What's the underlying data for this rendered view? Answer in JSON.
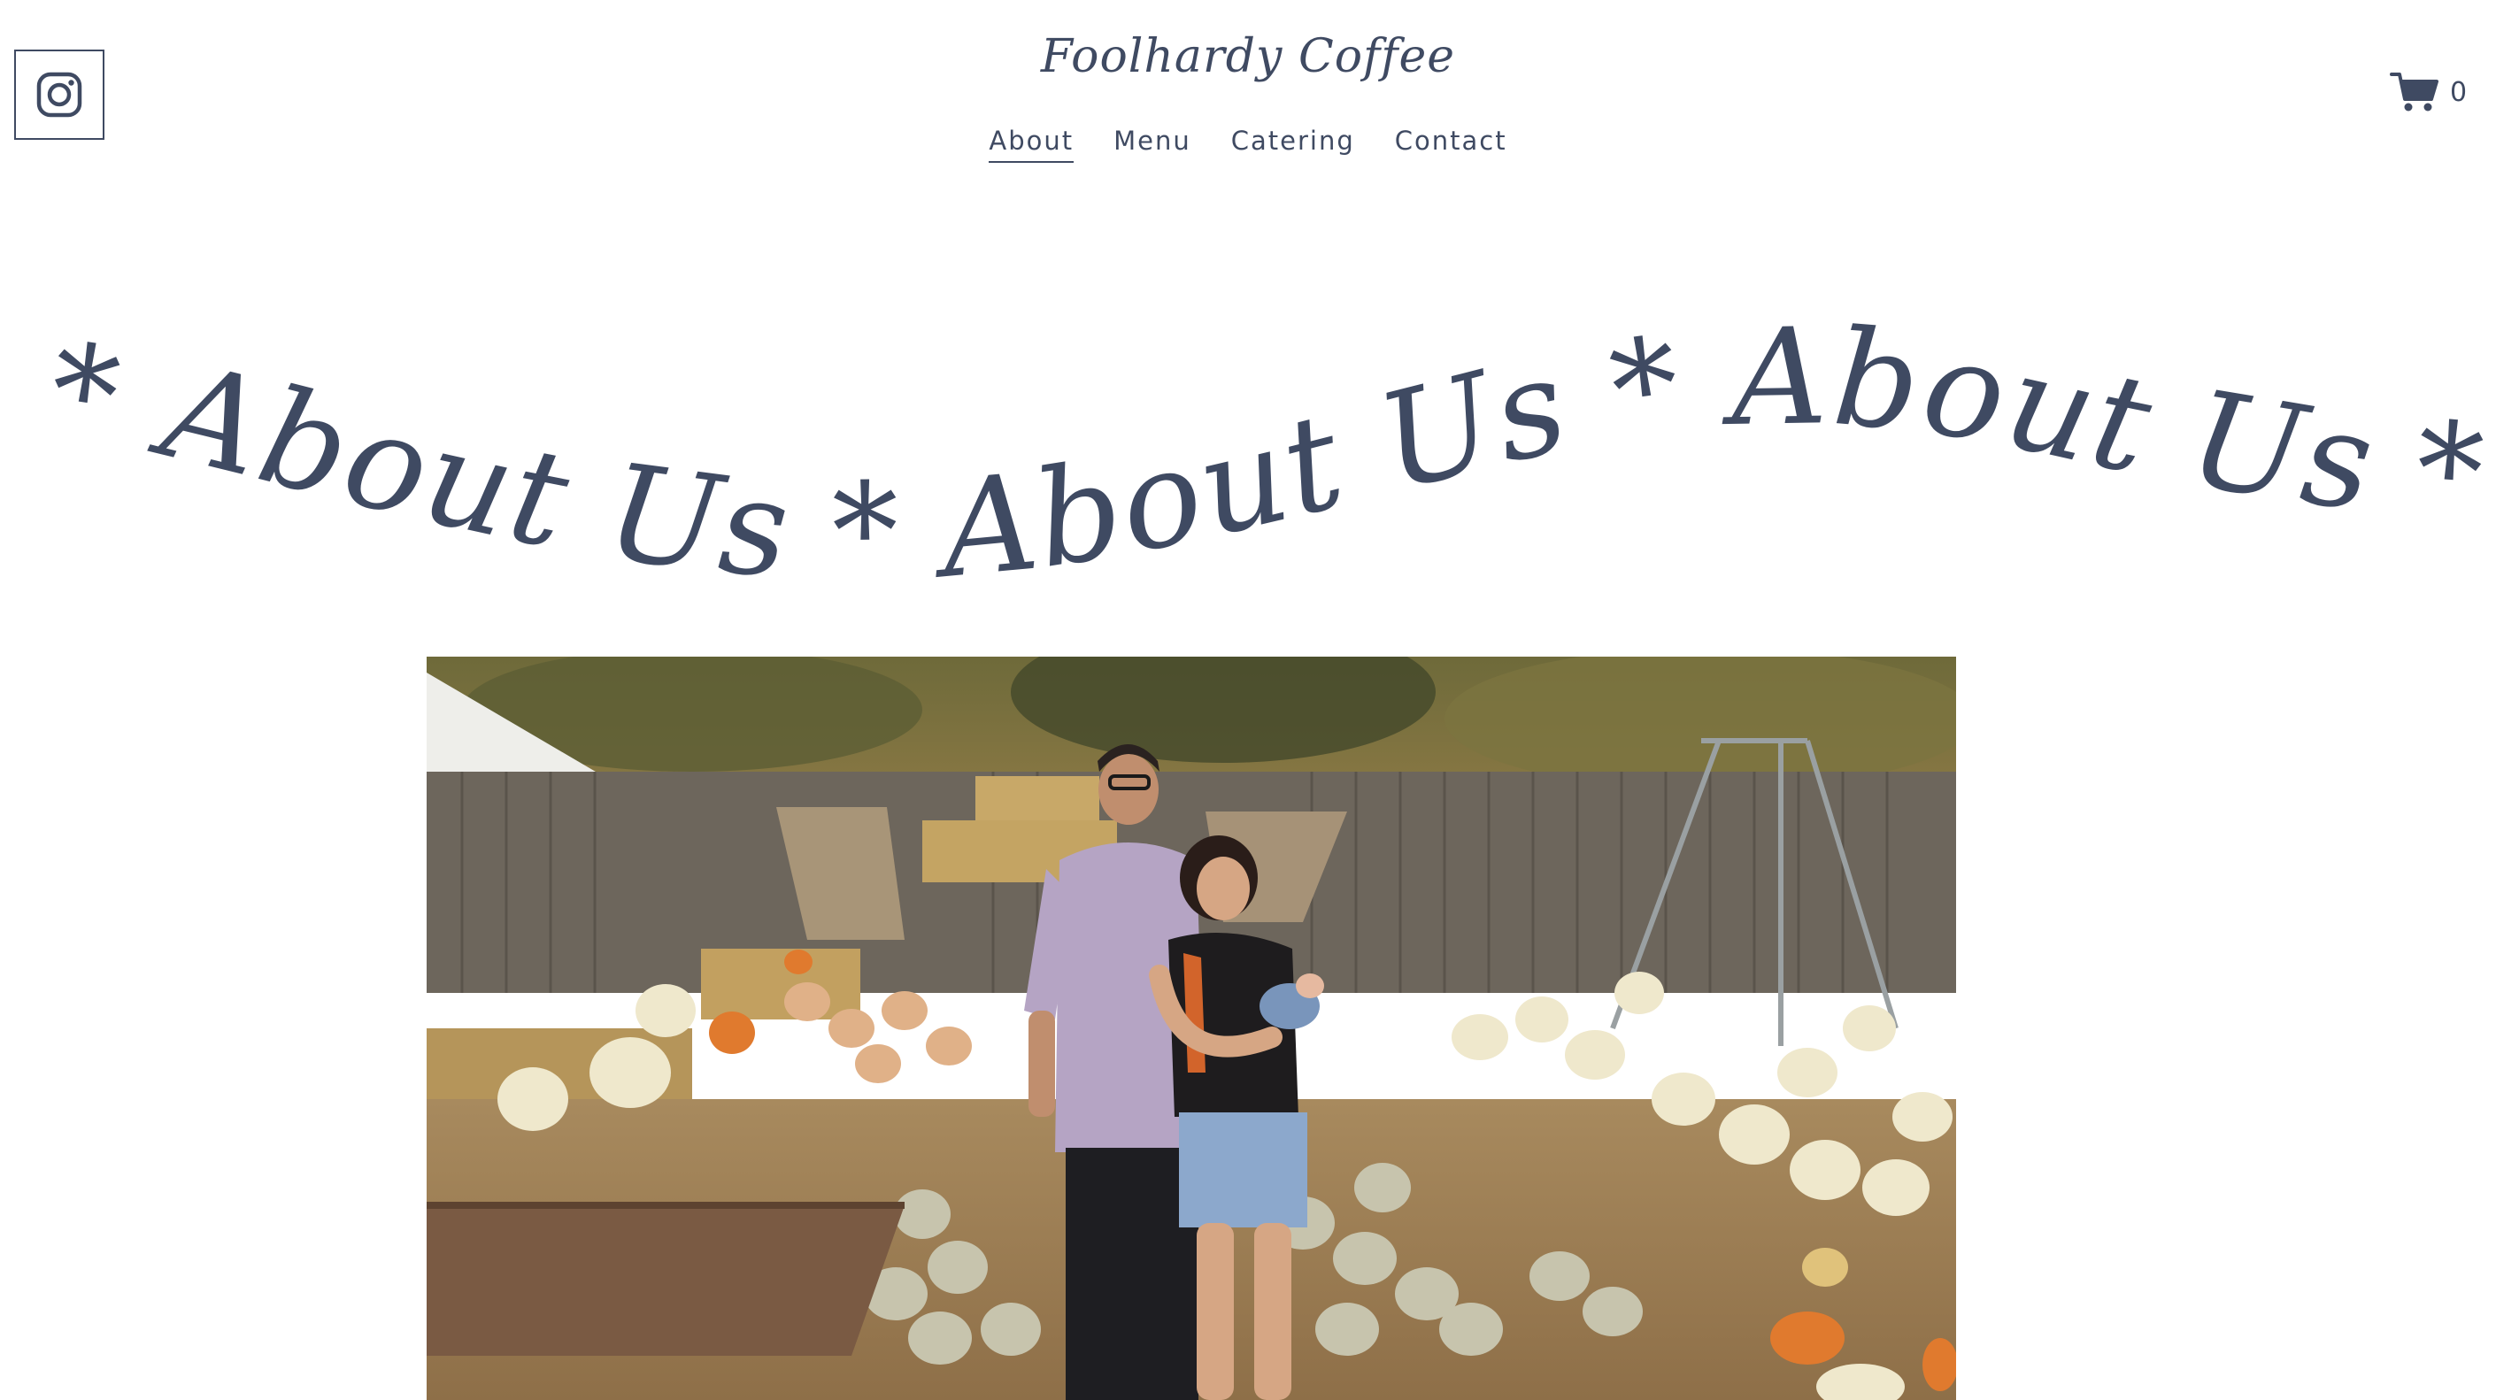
{
  "header": {
    "site_title": "Foolhardy Coffee",
    "nav": [
      {
        "label": "About",
        "active": true
      },
      {
        "label": "Menu",
        "active": false
      },
      {
        "label": "Catering",
        "active": false
      },
      {
        "label": "Contact",
        "active": false
      }
    ],
    "social_icon": "instagram-icon",
    "cart_icon": "cart-icon",
    "cart_count": "0"
  },
  "marquee": {
    "text": "About Us * About Us * About Us * About Us * About Us * About Us * About Us"
  },
  "photo": {
    "subject": "couple-with-baby-pumpkin-patch"
  },
  "colors": {
    "brand_text": "#3f4a62",
    "background": "#ffffff"
  }
}
